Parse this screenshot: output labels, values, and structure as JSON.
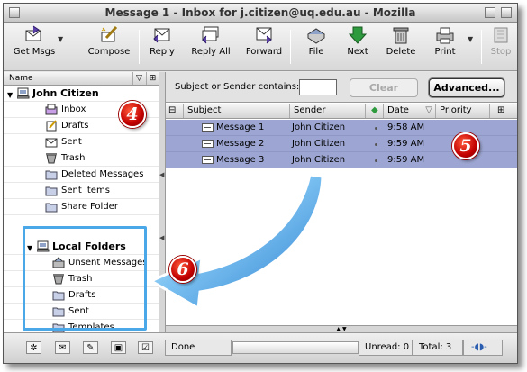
{
  "window": {
    "title": "Message 1 - Inbox for j.citizen@uq.edu.au - Mozilla"
  },
  "toolbar": {
    "buttons": [
      {
        "label": "Get Msgs",
        "icon": "get-msgs-icon"
      },
      {
        "label": "Compose",
        "icon": "compose-icon"
      },
      {
        "label": "Reply",
        "icon": "reply-icon"
      },
      {
        "label": "Reply All",
        "icon": "reply-all-icon"
      },
      {
        "label": "Forward",
        "icon": "forward-icon"
      },
      {
        "label": "File",
        "icon": "file-icon"
      },
      {
        "label": "Next",
        "icon": "next-icon"
      },
      {
        "label": "Delete",
        "icon": "delete-icon"
      },
      {
        "label": "Print",
        "icon": "print-icon"
      },
      {
        "label": "Stop",
        "icon": "stop-icon"
      }
    ]
  },
  "folder_pane": {
    "header": "Name",
    "account1": {
      "name": "John Citizen",
      "folders": [
        "Inbox",
        "Drafts",
        "Sent",
        "Trash",
        "Deleted Messages",
        "Sent Items",
        "Share Folder"
      ]
    },
    "account2": {
      "name": "Local Folders",
      "folders": [
        "Unsent Messages",
        "Trash",
        "Drafts",
        "Sent",
        "Templates"
      ]
    }
  },
  "search": {
    "label": "Subject or Sender contains:",
    "value": "",
    "clear_label": "Clear",
    "advanced_label": "Advanced..."
  },
  "thread_pane": {
    "columns": {
      "subject": "Subject",
      "sender": "Sender",
      "date": "Date",
      "priority": "Priority"
    },
    "rows": [
      {
        "subject": "Message 1",
        "sender": "John Citizen",
        "date": "9:58 AM",
        "priority": ""
      },
      {
        "subject": "Message 2",
        "sender": "John Citizen",
        "date": "9:59 AM",
        "priority": ""
      },
      {
        "subject": "Message 3",
        "sender": "John Citizen",
        "date": "9:59 AM",
        "priority": ""
      }
    ]
  },
  "status": {
    "text": "Done",
    "unread": "Unread: 0",
    "total": "Total: 3"
  },
  "annotations": {
    "four": "4",
    "five": "5",
    "six": "6"
  },
  "colors": {
    "selection": "#9da6d2",
    "highlight_box": "#4aa8e8",
    "badge": "#c20000"
  }
}
